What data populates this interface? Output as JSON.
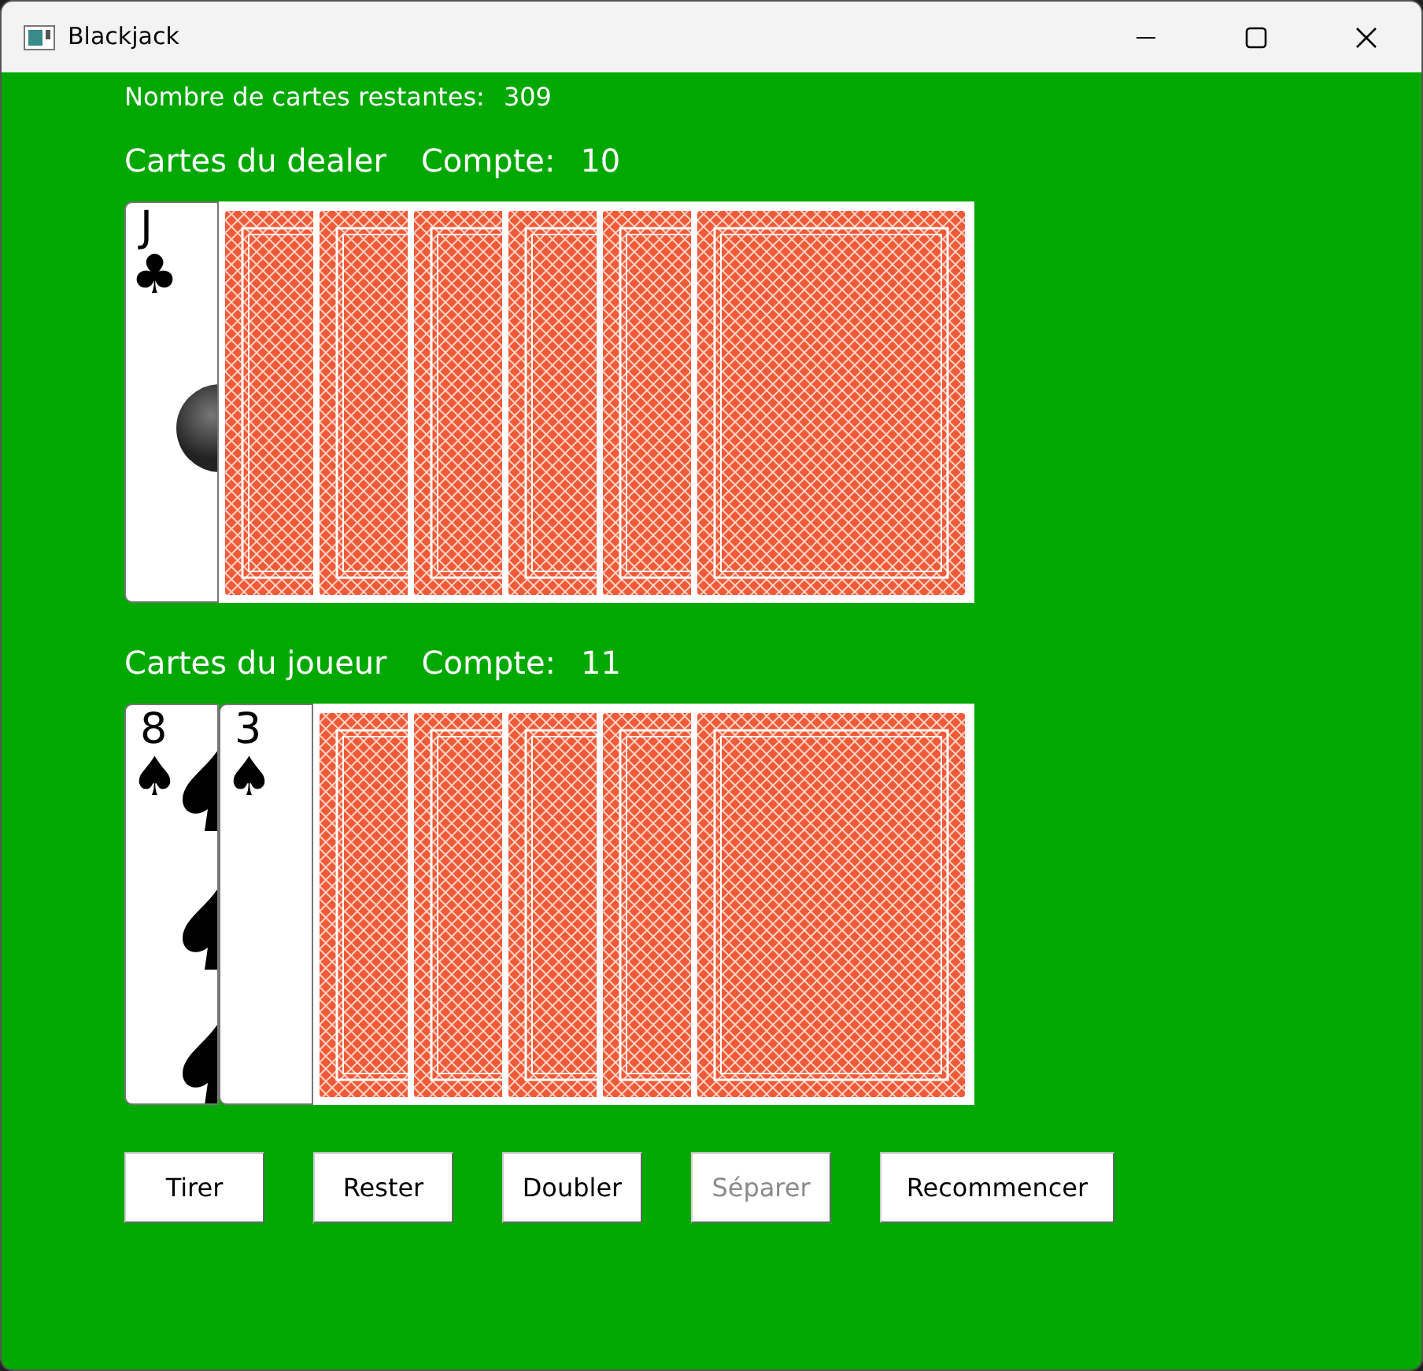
{
  "window": {
    "title": "Blackjack"
  },
  "remaining": {
    "label": "Nombre de cartes restantes:",
    "value": "309"
  },
  "hands": [
    {
      "title": "Cartes du dealer",
      "count_label": "Compte:",
      "count": "10",
      "cards": [
        {
          "kind": "face",
          "rank": "J",
          "suit": "♣"
        },
        {
          "kind": "back"
        },
        {
          "kind": "back"
        },
        {
          "kind": "back"
        },
        {
          "kind": "back"
        },
        {
          "kind": "back"
        },
        {
          "kind": "back"
        }
      ]
    },
    {
      "title": "Cartes du joueur",
      "count_label": "Compte:",
      "count": "11",
      "cards": [
        {
          "kind": "face",
          "rank": "8",
          "suit": "♠"
        },
        {
          "kind": "face",
          "rank": "3",
          "suit": "♠"
        },
        {
          "kind": "back"
        },
        {
          "kind": "back"
        },
        {
          "kind": "back"
        },
        {
          "kind": "back"
        },
        {
          "kind": "back"
        }
      ]
    }
  ],
  "buttons": [
    {
      "label": "Tirer",
      "disabled": false
    },
    {
      "label": "Rester",
      "disabled": false
    },
    {
      "label": "Doubler",
      "disabled": false
    },
    {
      "label": "Séparer",
      "disabled": true
    },
    {
      "label": "Recommencer",
      "disabled": false
    }
  ]
}
